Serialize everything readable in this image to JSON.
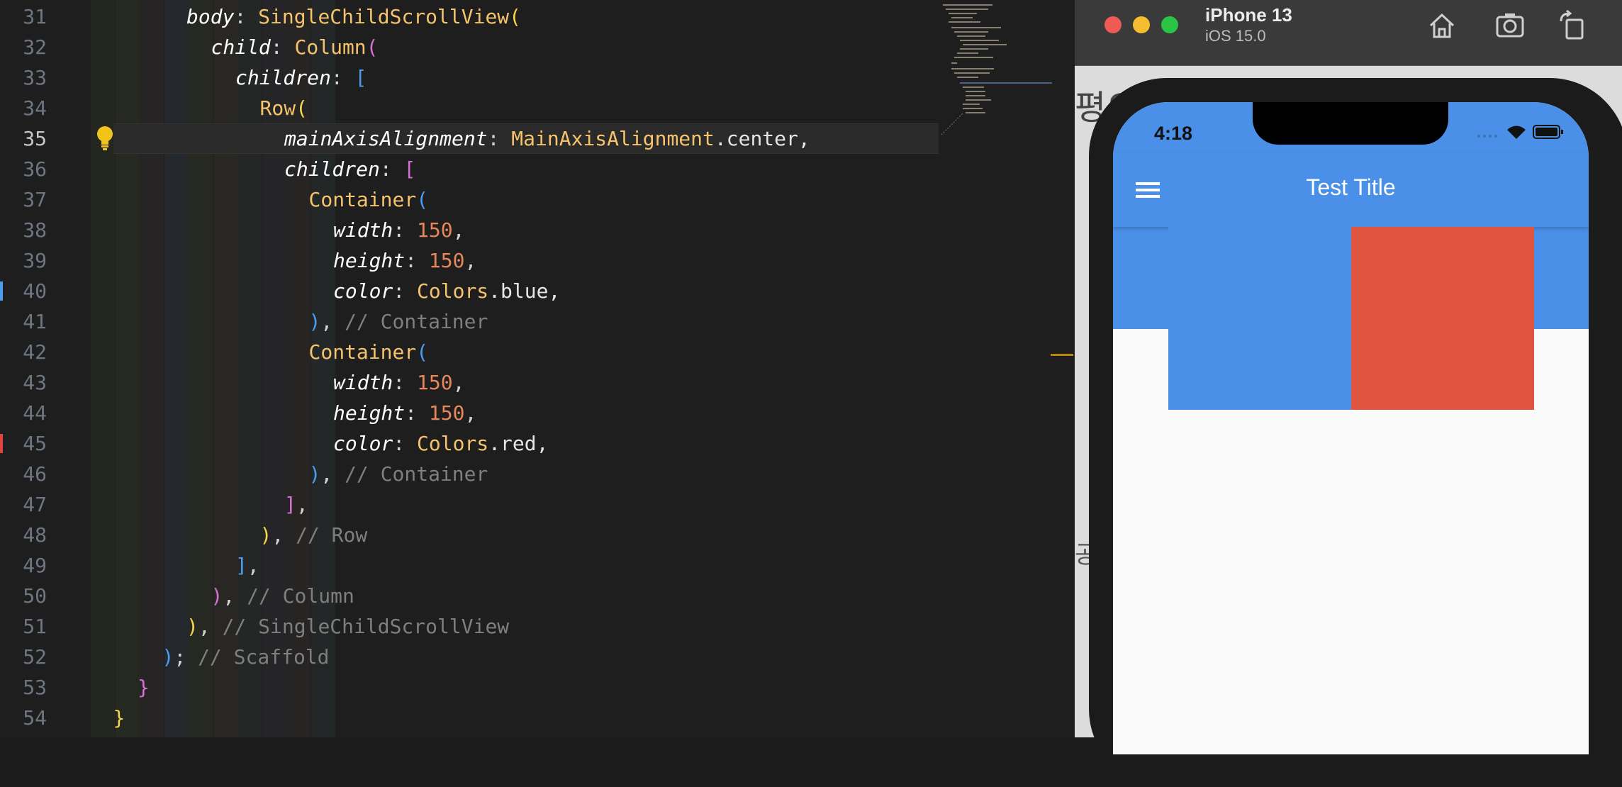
{
  "editor": {
    "lines": [
      {
        "num": "31",
        "indent": 6,
        "tokens": [
          [
            "k",
            "body"
          ],
          [
            "p",
            ": "
          ],
          [
            "t",
            "SingleChildScrollView"
          ],
          [
            "b1",
            "("
          ]
        ]
      },
      {
        "num": "32",
        "indent": 7,
        "tokens": [
          [
            "k",
            "child"
          ],
          [
            "p",
            ": "
          ],
          [
            "t",
            "Column"
          ],
          [
            "b2",
            "("
          ]
        ]
      },
      {
        "num": "33",
        "indent": 8,
        "tokens": [
          [
            "k",
            "children"
          ],
          [
            "p",
            ": "
          ],
          [
            "b3",
            "["
          ]
        ]
      },
      {
        "num": "34",
        "indent": 9,
        "tokens": [
          [
            "t",
            "Row"
          ],
          [
            "b1",
            "("
          ]
        ]
      },
      {
        "num": "35",
        "indent": 10,
        "current": true,
        "tokens": [
          [
            "k",
            "mainAxisAlignment"
          ],
          [
            "p",
            ": "
          ],
          [
            "t",
            "MainAxisAlignment"
          ],
          [
            "w",
            ".center,"
          ]
        ]
      },
      {
        "num": "36",
        "indent": 10,
        "tokens": [
          [
            "k",
            "children"
          ],
          [
            "p",
            ": "
          ],
          [
            "b2",
            "["
          ]
        ]
      },
      {
        "num": "37",
        "indent": 11,
        "tokens": [
          [
            "t",
            "Container"
          ],
          [
            "b3",
            "("
          ]
        ]
      },
      {
        "num": "38",
        "indent": 12,
        "tokens": [
          [
            "k",
            "width"
          ],
          [
            "p",
            ": "
          ],
          [
            "n",
            "150"
          ],
          [
            "p",
            ","
          ]
        ]
      },
      {
        "num": "39",
        "indent": 12,
        "tokens": [
          [
            "k",
            "height"
          ],
          [
            "p",
            ": "
          ],
          [
            "n",
            "150"
          ],
          [
            "p",
            ","
          ]
        ]
      },
      {
        "num": "40",
        "indent": 12,
        "mark": "#4b9cf0",
        "tokens": [
          [
            "k",
            "color"
          ],
          [
            "p",
            ": "
          ],
          [
            "t",
            "Colors"
          ],
          [
            "w",
            ".blue,"
          ]
        ]
      },
      {
        "num": "41",
        "indent": 11,
        "tokens": [
          [
            "b3",
            ")"
          ],
          [
            "p",
            ", "
          ],
          [
            "c",
            "// Container"
          ]
        ]
      },
      {
        "num": "42",
        "indent": 11,
        "tokens": [
          [
            "t",
            "Container"
          ],
          [
            "b3",
            "("
          ]
        ]
      },
      {
        "num": "43",
        "indent": 12,
        "tokens": [
          [
            "k",
            "width"
          ],
          [
            "p",
            ": "
          ],
          [
            "n",
            "150"
          ],
          [
            "p",
            ","
          ]
        ]
      },
      {
        "num": "44",
        "indent": 12,
        "tokens": [
          [
            "k",
            "height"
          ],
          [
            "p",
            ": "
          ],
          [
            "n",
            "150"
          ],
          [
            "p",
            ","
          ]
        ]
      },
      {
        "num": "45",
        "indent": 12,
        "mark": "#e0443c",
        "tokens": [
          [
            "k",
            "color"
          ],
          [
            "p",
            ": "
          ],
          [
            "t",
            "Colors"
          ],
          [
            "w",
            ".red,"
          ]
        ]
      },
      {
        "num": "46",
        "indent": 11,
        "tokens": [
          [
            "b3",
            ")"
          ],
          [
            "p",
            ", "
          ],
          [
            "c",
            "// Container"
          ]
        ]
      },
      {
        "num": "47",
        "indent": 10,
        "tokens": [
          [
            "b2",
            "]"
          ],
          [
            "p",
            ","
          ]
        ]
      },
      {
        "num": "48",
        "indent": 9,
        "tokens": [
          [
            "b1",
            ")"
          ],
          [
            "p",
            ", "
          ],
          [
            "c",
            "// Row"
          ]
        ]
      },
      {
        "num": "49",
        "indent": 8,
        "tokens": [
          [
            "b3",
            "]"
          ],
          [
            "p",
            ","
          ]
        ]
      },
      {
        "num": "50",
        "indent": 7,
        "tokens": [
          [
            "b2",
            ")"
          ],
          [
            "p",
            ", "
          ],
          [
            "c",
            "// Column"
          ]
        ]
      },
      {
        "num": "51",
        "indent": 6,
        "tokens": [
          [
            "b1",
            ")"
          ],
          [
            "p",
            ", "
          ],
          [
            "c",
            "// SingleChildScrollView"
          ]
        ]
      },
      {
        "num": "52",
        "indent": 5,
        "tokens": [
          [
            "b3",
            ")"
          ],
          [
            "p",
            "; "
          ],
          [
            "c",
            "// Scaffold"
          ]
        ]
      },
      {
        "num": "53",
        "indent": 4,
        "tokens": [
          [
            "b2",
            "}"
          ]
        ]
      },
      {
        "num": "54",
        "indent": 3,
        "tokens": [
          [
            "b1",
            "}"
          ]
        ]
      }
    ]
  },
  "simulator": {
    "device_name": "iPhone 13",
    "os_version": "iOS 15.0",
    "toolbar_icons": [
      "home-icon",
      "screenshot-icon",
      "rotate-icon"
    ],
    "background_text_1": "평으",
    "background_text_2": "공"
  },
  "app": {
    "time": "4:18",
    "title": "Test Title",
    "accent": "#4a90e8",
    "boxes": [
      {
        "name": "blue-container",
        "color": "#4a90e8"
      },
      {
        "name": "red-container",
        "color": "#e05540"
      }
    ]
  }
}
